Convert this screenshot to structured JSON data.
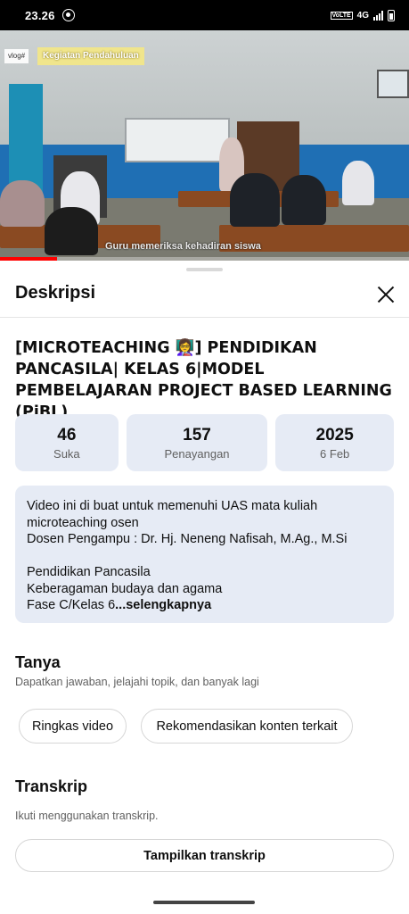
{
  "status_bar": {
    "time": "23.26",
    "network": "4G",
    "volte": "VoLTE"
  },
  "video": {
    "vlog_tag": "vlog#",
    "overlay_title": "Kegiatan Pendahuluan",
    "caption": "Guru memeriksa kehadiran siswa",
    "progress": 0.14
  },
  "sheet": {
    "title": "Deskripsi",
    "video_title": "[MICROTEACHING 👩‍🏫] PENDIDIKAN PANCASILA| KELAS 6|MODEL PEMBELAJARAN PROJECT BASED LEARNING (PjBL)",
    "stats": [
      {
        "value": "46",
        "label": "Suka"
      },
      {
        "value": "157",
        "label": "Penayangan"
      },
      {
        "value": "2025",
        "label": "6 Feb"
      }
    ],
    "description": {
      "lines": [
        "Video ini di buat untuk memenuhi UAS mata kuliah microteaching osen",
        "Dosen Pengampu : Dr. Hj. Neneng Nafisah, M.Ag., M.Si",
        "",
        "Pendidikan Pancasila",
        "Keberagaman budaya dan agama",
        "Fase C/Kelas 6"
      ],
      "more_label": "...selengkapnya"
    },
    "ask": {
      "title": "Tanya",
      "subtitle": "Dapatkan jawaban, jelajahi topik, dan banyak lagi",
      "chips": [
        "Ringkas video",
        "Rekomendasikan konten terkait"
      ]
    },
    "transcript": {
      "title": "Transkrip",
      "subtitle": "Ikuti menggunakan transkrip.",
      "button_label": "Tampilkan transkrip"
    }
  }
}
